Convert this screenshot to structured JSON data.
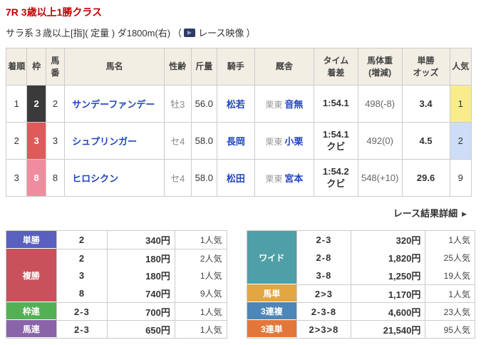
{
  "header": {
    "title": "7R 3歳以上1勝クラス",
    "conditions": "サラ系３歳以上[指]( 定量 ) ダ1800m(右)",
    "paren_open": "（",
    "video_label": "レース映像",
    "paren_close": "）"
  },
  "results": {
    "headers": [
      "着順",
      "枠",
      "馬番",
      "馬名",
      "性齢",
      "斤量",
      "騎手",
      "厩舎",
      "タイム\n着差",
      "馬体重\n(増減)",
      "単勝\nオッズ",
      "人気"
    ],
    "rows": [
      {
        "order": "1",
        "frame": "2",
        "number": "2",
        "name": "サンデーファンデー",
        "sex_age": "牡3",
        "weight": "56.0",
        "jockey": "松若",
        "stable_area": "栗東",
        "stable": "音無",
        "time": "1:54.1",
        "margin": "",
        "horse_weight": "498(-8)",
        "odds": "3.4",
        "popularity": "1"
      },
      {
        "order": "2",
        "frame": "3",
        "number": "3",
        "name": "シュプリンガー",
        "sex_age": "セ4",
        "weight": "58.0",
        "jockey": "長岡",
        "stable_area": "栗東",
        "stable": "小栗",
        "time": "1:54.1",
        "margin": "クビ",
        "horse_weight": "492(0)",
        "odds": "4.5",
        "popularity": "2"
      },
      {
        "order": "3",
        "frame": "8",
        "number": "8",
        "name": "ヒロシクン",
        "sex_age": "セ4",
        "weight": "58.0",
        "jockey": "松田",
        "stable_area": "栗東",
        "stable": "宮本",
        "time": "1:54.2",
        "margin": "クビ",
        "horse_weight": "548(+10)",
        "odds": "29.6",
        "popularity": "9"
      }
    ]
  },
  "detail_link": {
    "label": "レース結果詳細",
    "arrow": "▶"
  },
  "pay_left": {
    "tansho": {
      "label": "単勝",
      "combo": "2",
      "pay": "340円",
      "pop": "1人気"
    },
    "fukusho": {
      "label": "複勝",
      "rows": [
        {
          "combo": "2",
          "pay": "180円",
          "pop": "2人気"
        },
        {
          "combo": "3",
          "pay": "180円",
          "pop": "1人気"
        },
        {
          "combo": "8",
          "pay": "740円",
          "pop": "9人気"
        }
      ]
    },
    "wakuren": {
      "label": "枠連",
      "combo": "2-3",
      "pay": "700円",
      "pop": "1人気"
    },
    "umaren": {
      "label": "馬連",
      "combo": "2-3",
      "pay": "650円",
      "pop": "1人気"
    }
  },
  "pay_right": {
    "wide": {
      "label": "ワイド",
      "rows": [
        {
          "combo": "2-3",
          "pay": "320円",
          "pop": "1人気"
        },
        {
          "combo": "2-8",
          "pay": "1,820円",
          "pop": "25人気"
        },
        {
          "combo": "3-8",
          "pay": "1,250円",
          "pop": "19人気"
        }
      ]
    },
    "umatan": {
      "label": "馬単",
      "combo": "2>3",
      "pay": "1,170円",
      "pop": "1人気"
    },
    "sanrenpuku": {
      "label": "3連複",
      "combo": "2-3-8",
      "pay": "4,600円",
      "pop": "23人気"
    },
    "sanrentan": {
      "label": "3連単",
      "combo": "2>3>8",
      "pay": "21,540円",
      "pop": "95人気"
    }
  },
  "colors": {
    "accent_red": "#c00000",
    "link_blue": "#2144bf",
    "frame_2": "#3a3a3a",
    "frame_3": "#df5a5a",
    "frame_8": "#ef8d9e",
    "pop_1": "#f8ec8d",
    "pop_2": "#cdddf7",
    "tansho": "#5a60bf",
    "fukusho": "#c9515b",
    "wakuren": "#54b054",
    "umaren": "#8a64a8",
    "wide": "#4f9fa6",
    "umatan": "#e3a641",
    "sanrenpuku": "#4e86b7",
    "sanrentan": "#e3763b"
  }
}
